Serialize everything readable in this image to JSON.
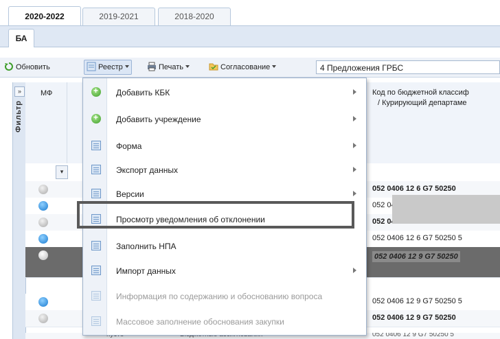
{
  "year_tabs": [
    "2020-2022",
    "2019-2021",
    "2018-2020"
  ],
  "inner_tab": "БА",
  "toolbar": {
    "refresh": "Обновить",
    "registry": "Реестр",
    "print": "Печать",
    "approval": "Согласование",
    "combo_value": "4 Предложения ГРБС"
  },
  "filter_label": "Фильтр",
  "filter_arrows": "»",
  "grid": {
    "col_mf": "МФ",
    "col_code_line1": "Код по бюджетной классиф",
    "col_code_line2": "/ Курирующий департаме"
  },
  "rows": [
    {
      "code": "052 0406 12 6 G7 50250"
    },
    {
      "code": "052 04"
    },
    {
      "code": "052 0406 12 6 G7 50250"
    },
    {
      "code": "052 0406 12 6 G7 50250 5"
    },
    {
      "code": "052 0406 12 9 G7 50250"
    },
    {
      "code": "052 0406 12 9 G7 50250 5"
    },
    {
      "code": "052 0406 12 9 G7 50250"
    }
  ],
  "bottom_row": {
    "left": "пусто",
    "middle": "Бюджетные ассигнования",
    "code": "052 0406 12 9 G7 50250 5"
  },
  "menu": {
    "items": [
      {
        "label": "Добавить КБК",
        "icon": "plus-icon",
        "submenu": true,
        "disabled": false
      },
      {
        "label": "Добавить учреждение",
        "icon": "plus-icon",
        "submenu": true,
        "disabled": false
      },
      {
        "label": "Форма",
        "icon": "document-icon",
        "submenu": true,
        "disabled": false
      },
      {
        "label": "Экспорт данных",
        "icon": "document-icon",
        "submenu": true,
        "disabled": false
      },
      {
        "label": "Версии",
        "icon": "document-icon",
        "submenu": true,
        "disabled": false
      },
      {
        "label": "Просмотр уведомления об отклонении",
        "icon": "document-icon",
        "submenu": false,
        "disabled": false
      },
      {
        "label": "Заполнить НПА",
        "icon": "document-icon",
        "submenu": false,
        "disabled": false
      },
      {
        "label": "Импорт данных",
        "icon": "document-icon",
        "submenu": true,
        "disabled": false
      },
      {
        "label": "Информация по содержанию и обоснованию вопроса",
        "icon": "document-icon",
        "submenu": false,
        "disabled": true
      },
      {
        "label": "Массовое заполнение обоснования закупки",
        "icon": "document-icon",
        "submenu": false,
        "disabled": true
      }
    ]
  },
  "colors": {
    "accent": "#595959",
    "header_bg": "#dfe8f4",
    "selected_row": "#6b6b6b"
  }
}
